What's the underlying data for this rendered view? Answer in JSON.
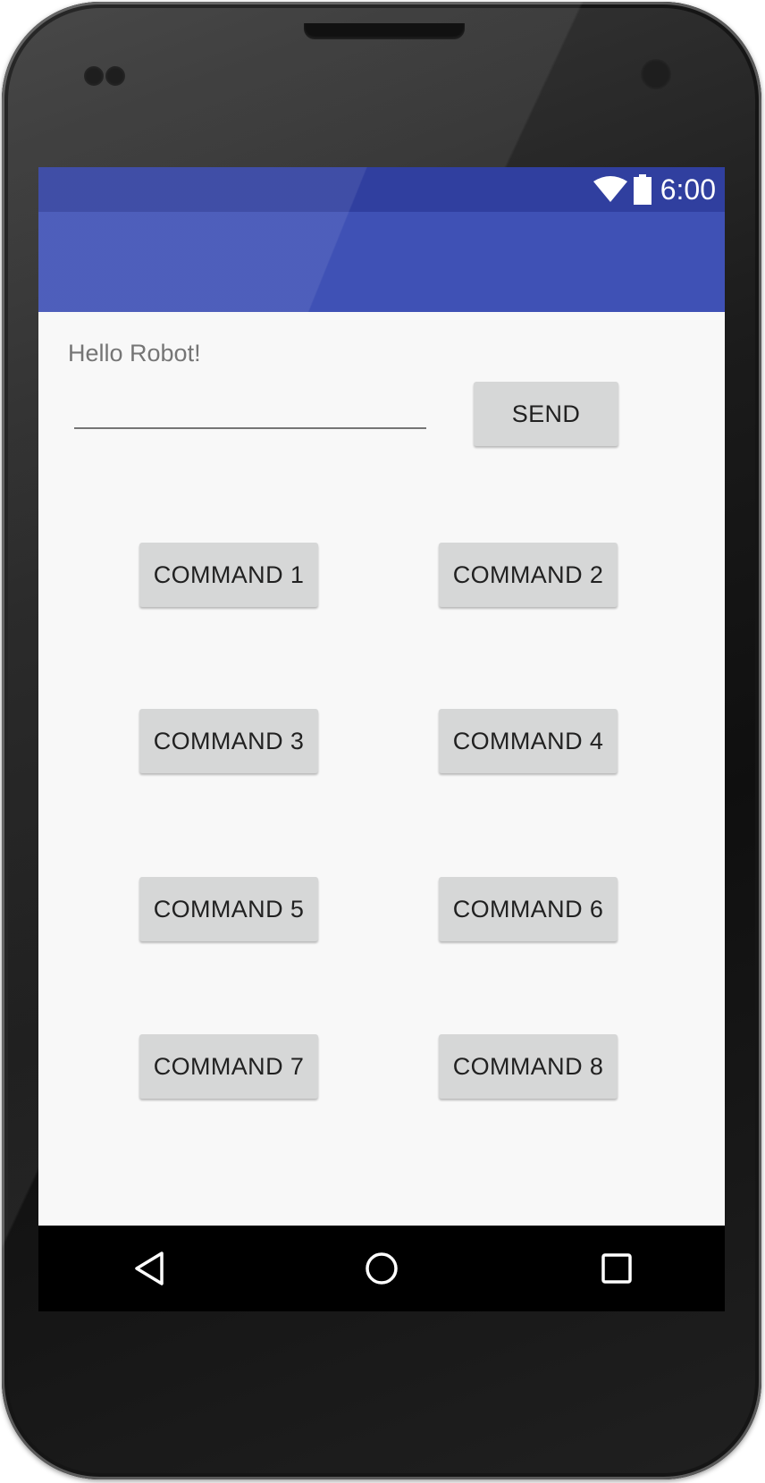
{
  "status_bar": {
    "time": "6:00",
    "icons": [
      "wifi-icon",
      "battery-icon"
    ],
    "color": "#303f9f"
  },
  "app_bar": {
    "title": "",
    "color": "#3f51b5"
  },
  "main": {
    "greeting": "Hello Robot!",
    "message_input": {
      "value": "",
      "placeholder": ""
    },
    "send_label": "SEND",
    "commands": [
      {
        "label": "COMMAND 1"
      },
      {
        "label": "COMMAND 2"
      },
      {
        "label": "COMMAND 3"
      },
      {
        "label": "COMMAND 4"
      },
      {
        "label": "COMMAND 5"
      },
      {
        "label": "COMMAND 6"
      },
      {
        "label": "COMMAND 7"
      },
      {
        "label": "COMMAND 8"
      }
    ]
  },
  "nav_bar": {
    "buttons": [
      "back-icon",
      "home-icon",
      "recents-icon"
    ]
  },
  "colors": {
    "primary": "#3f51b5",
    "primary_dark": "#303f9f",
    "background": "#f8f8f8",
    "button": "#d6d7d7"
  }
}
